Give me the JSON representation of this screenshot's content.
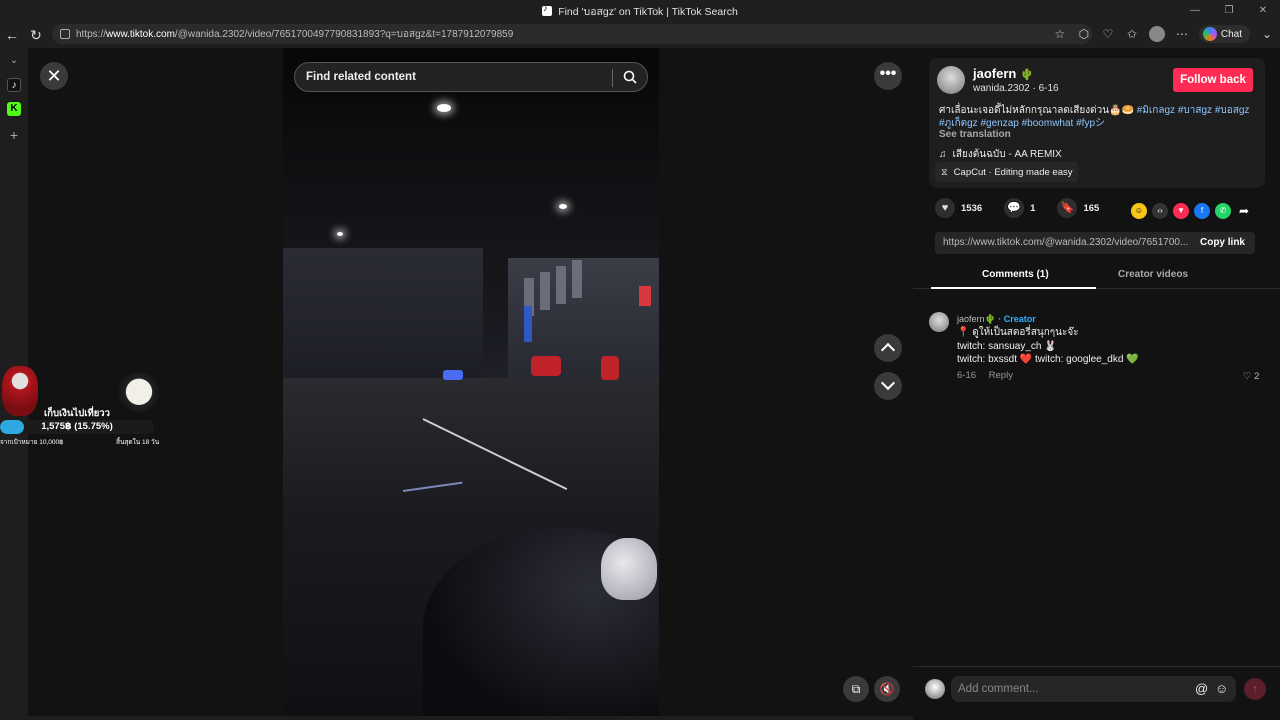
{
  "window": {
    "title": "Find 'บอสgz' on TikTok | TikTok Search"
  },
  "browser": {
    "url_prefix": "https://",
    "url_domain": "www.tiktok.com",
    "url_path": "/@wanida.2302/video/7651700497790831893?q=บอสgz&t=1787912079859",
    "chat_label": "Chat"
  },
  "video": {
    "search_placeholder": "Find related content"
  },
  "overlay": {
    "title": "เก็บเงินไปเที่ยวว",
    "amount": "1,575฿ (15.75%)",
    "progress": 0.1575,
    "goal": "จากเป้าหมาย 10,000฿",
    "ends": "สิ้นสุดใน 18 วัน"
  },
  "post": {
    "username": "jaofern",
    "username_emoji": "🌵",
    "handle": "wanida.2302 · 6-16",
    "follow_label": "Follow back",
    "caption_text": "ศาเลื่อนะเจอดี้ไม่หลักกรุณาลดเสียงด่วน🎂🥯 ",
    "hashtags_line1": [
      "#มิเกลgz",
      "#บาสgz",
      "#บอสgz"
    ],
    "hashtags_line2": [
      "#ภูเก็ตgz",
      "#genzap",
      "#boomwhat",
      "#fypシ"
    ],
    "see_translation": "See translation",
    "music": "เสียงต้นฉบับ - AA REMIX",
    "capcut": "CapCut · Editing made easy",
    "likes": "1536",
    "comments": "1",
    "saves": "165",
    "link": "https://www.tiktok.com/@wanida.2302/video/7651700...",
    "copy_link": "Copy link"
  },
  "tabs": {
    "comments": "Comments (1)",
    "creator_videos": "Creator videos"
  },
  "comment": {
    "user": "jaofern🌵",
    "creator_tag": " · Creator",
    "line1": "📍 ดูให้เป็นสตอรี่สนุกๆนะจ๊ะ",
    "line2": "twitch: sansuay_ch 🐰",
    "line3": "twitch: bxssdt ❤️ twitch: googlee_dkd 💚",
    "date": "6-16",
    "reply": "Reply",
    "likes": "2"
  },
  "compose": {
    "placeholder": "Add comment..."
  }
}
